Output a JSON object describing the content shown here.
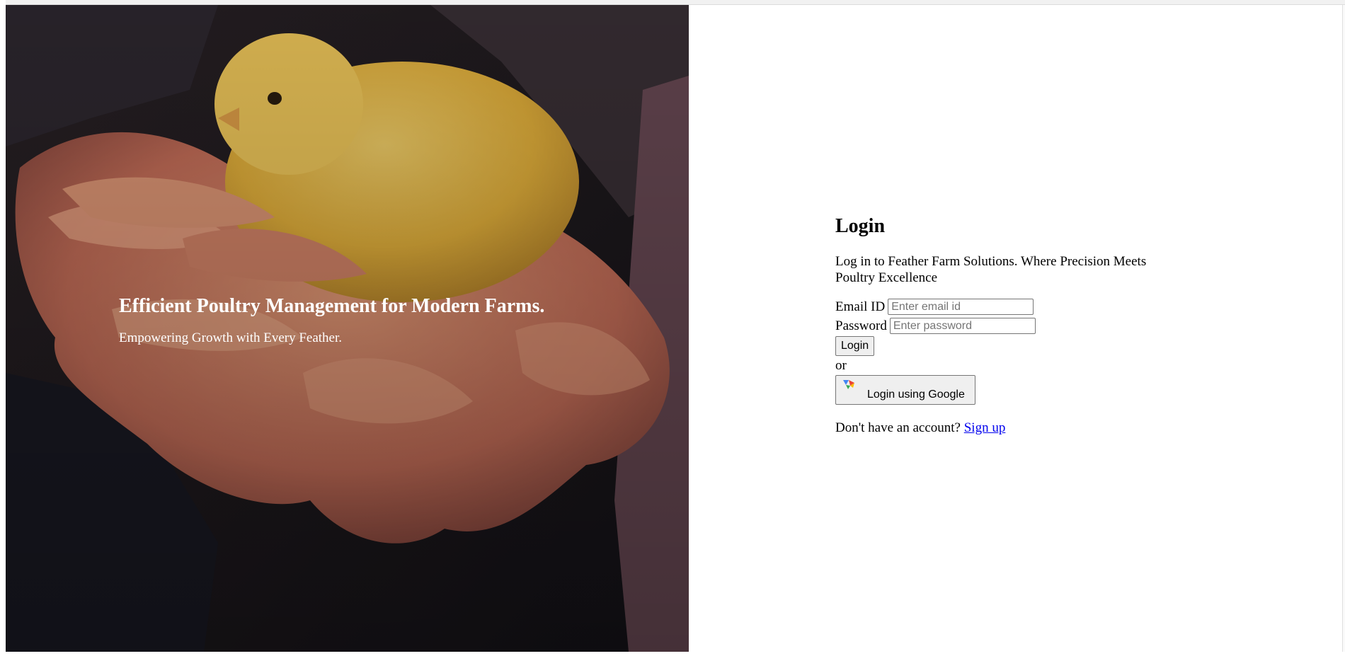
{
  "hero": {
    "title": "Efficient Poultry Management for Modern Farms.",
    "subtitle": "Empowering Growth with Every Feather.",
    "image_subject": "hands holding a yellow baby chick"
  },
  "login": {
    "title": "Login",
    "tagline": "Log in to Feather Farm Solutions. Where Precision Meets Poultry Excellence",
    "email_label": "Email ID",
    "email_placeholder": "Enter email id",
    "email_value": "",
    "password_label": "Password",
    "password_placeholder": "Enter password",
    "password_value": "",
    "login_button": "Login",
    "or_text": "or",
    "google_button": "Login using Google",
    "google_icon": "google-logo-icon",
    "signup_prompt": "Don't have an account?",
    "signup_link": "Sign up"
  },
  "colors": {
    "hero_overlay": "#1c1a1c",
    "chick": "#f2c24a",
    "hands": "#e08a68",
    "link": "#0000ee"
  }
}
